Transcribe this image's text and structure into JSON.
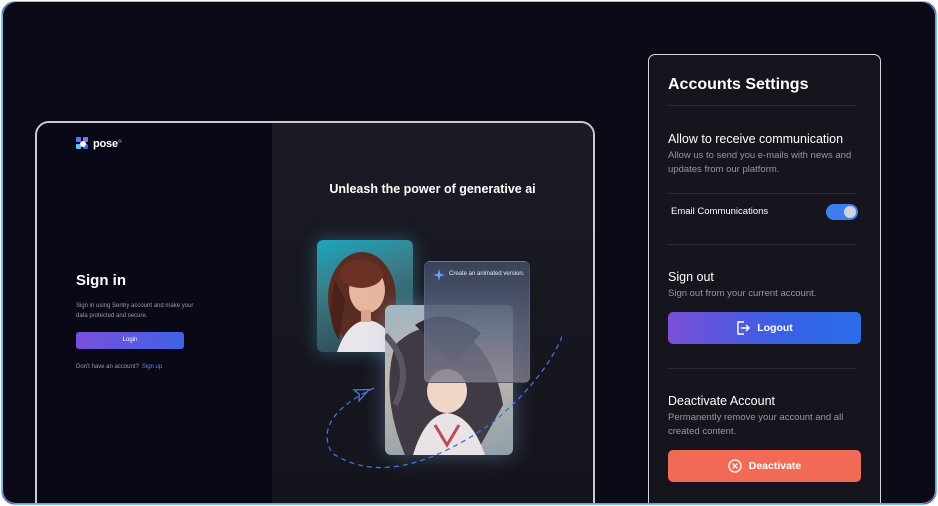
{
  "device": {
    "logo_text": "pose",
    "logo_sup": "ai",
    "signin_title": "Sign in",
    "signin_desc": "Sign in using Sentry account and make your data protected and secure.",
    "login_label": "Login",
    "no_account_text": "Don't have an account?",
    "signup_label": "Sign up",
    "headline": "Unleash the power of generative ai",
    "card_caption": "Create an animated version."
  },
  "settings": {
    "title": "Accounts Settings",
    "communication": {
      "title": "Allow to receive communication",
      "desc": "Allow us to send you e-mails with news and updates from our platform.",
      "email_label": "Email Communications",
      "email_enabled": true
    },
    "signout": {
      "title": "Sign out",
      "desc": "Sign out from your current account.",
      "button_label": "Logout"
    },
    "deactivate": {
      "title": "Deactivate Account",
      "desc": "Permanently remove your account and all created content.",
      "button_label": "Deactivate"
    }
  },
  "colors": {
    "accent_blue": "#3f7df0",
    "accent_purple": "#7b4fd7",
    "danger": "#f06a55"
  }
}
